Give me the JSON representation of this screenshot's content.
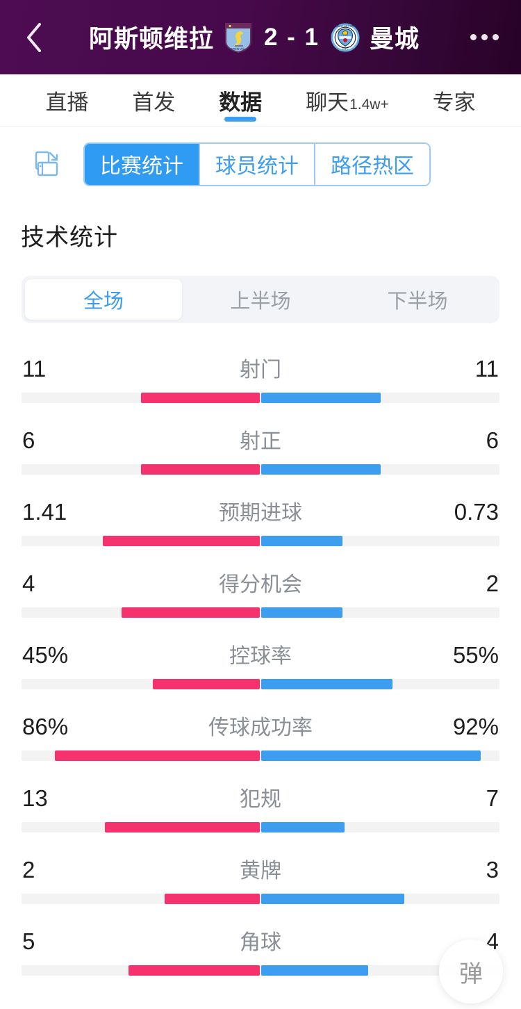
{
  "header": {
    "back_icon": "chevron-left-icon",
    "home_team": "阿斯顿维拉",
    "away_team": "曼城",
    "score": "2 - 1",
    "home_crest": "aston-villa-crest",
    "away_crest": "manchester-city-crest",
    "more_icon": "more-horizontal-icon",
    "bg_color": "#47094b"
  },
  "tabs": [
    {
      "label": "直播",
      "badge": "",
      "active": false
    },
    {
      "label": "首发",
      "badge": "",
      "active": false
    },
    {
      "label": "数据",
      "badge": "",
      "active": true
    },
    {
      "label": "聊天",
      "badge": "1.4w+",
      "active": false
    },
    {
      "label": "专家",
      "badge": "",
      "active": false
    }
  ],
  "segment": {
    "rotate_icon": "rotate-screen-icon",
    "items": [
      {
        "label": "比赛统计",
        "active": true
      },
      {
        "label": "球员统计",
        "active": false
      },
      {
        "label": "路径热区",
        "active": false
      }
    ],
    "accent": "#2f9bf2"
  },
  "section_title": "技术统计",
  "period": {
    "items": [
      {
        "label": "全场",
        "active": true
      },
      {
        "label": "上半场",
        "active": false
      },
      {
        "label": "下半场",
        "active": false
      }
    ]
  },
  "chart_data": {
    "type": "bar",
    "title": "技术统计",
    "subtitle": "全场",
    "orientation": "horizontal-diverging",
    "series": [
      {
        "name": "阿斯顿维拉",
        "color": "#f5316e",
        "side": "left"
      },
      {
        "name": "曼城",
        "color": "#3d9ef0",
        "side": "right"
      }
    ],
    "categories": [
      "射门",
      "射正",
      "预期进球",
      "得分机会",
      "控球率",
      "传球成功率",
      "犯规",
      "黄牌",
      "角球"
    ],
    "home_values": [
      "11",
      "6",
      "1.41",
      "4",
      "45%",
      "86%",
      "13",
      "2",
      "5"
    ],
    "away_values": [
      "11",
      "6",
      "0.73",
      "2",
      "55%",
      "92%",
      "7",
      "3",
      "4"
    ],
    "home_fractions": [
      0.5,
      0.5,
      0.66,
      0.58,
      0.45,
      0.86,
      0.65,
      0.4,
      0.55
    ],
    "away_fractions": [
      0.5,
      0.5,
      0.34,
      0.34,
      0.55,
      0.92,
      0.35,
      0.6,
      0.45
    ],
    "grid": false,
    "legend": "none"
  },
  "stats": [
    {
      "name": "射门",
      "home": "11",
      "away": "11",
      "home_frac": 0.5,
      "away_frac": 0.5
    },
    {
      "name": "射正",
      "home": "6",
      "away": "6",
      "home_frac": 0.5,
      "away_frac": 0.5
    },
    {
      "name": "预期进球",
      "home": "1.41",
      "away": "0.73",
      "home_frac": 0.66,
      "away_frac": 0.34
    },
    {
      "name": "得分机会",
      "home": "4",
      "away": "2",
      "home_frac": 0.58,
      "away_frac": 0.34
    },
    {
      "name": "控球率",
      "home": "45%",
      "away": "55%",
      "home_frac": 0.45,
      "away_frac": 0.55
    },
    {
      "name": "传球成功率",
      "home": "86%",
      "away": "92%",
      "home_frac": 0.86,
      "away_frac": 0.92
    },
    {
      "name": "犯规",
      "home": "13",
      "away": "7",
      "home_frac": 0.65,
      "away_frac": 0.35
    },
    {
      "name": "黄牌",
      "home": "2",
      "away": "3",
      "home_frac": 0.4,
      "away_frac": 0.6
    },
    {
      "name": "角球",
      "home": "5",
      "away": "4",
      "home_frac": 0.55,
      "away_frac": 0.45
    }
  ],
  "fab": {
    "label": "弹"
  },
  "colors": {
    "home_bar": "#f5316e",
    "away_bar": "#3d9ef0",
    "track": "#f3f3f4",
    "accent": "#3d9ef0"
  }
}
